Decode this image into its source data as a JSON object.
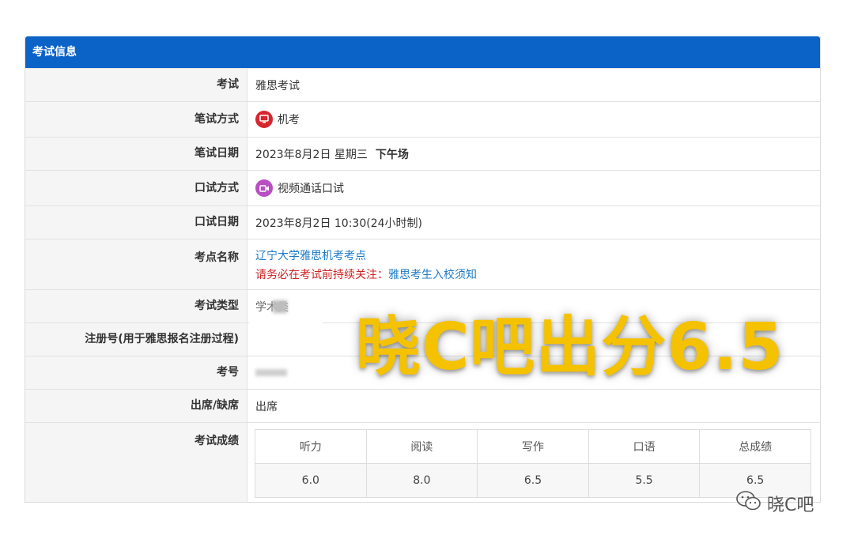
{
  "panel": {
    "title": "考试信息"
  },
  "rows": {
    "exam": {
      "label": "考试",
      "value": "雅思考试"
    },
    "written_mode": {
      "label": "笔试方式",
      "value": "机考",
      "icon": "monitor-icon"
    },
    "written_date": {
      "label": "笔试日期",
      "value": "2023年8月2日 星期三",
      "session": "下午场"
    },
    "oral_mode": {
      "label": "口试方式",
      "value": "视频通话口试",
      "icon": "video-icon"
    },
    "oral_date": {
      "label": "口试日期",
      "value": "2023年8月2日 10:30(24小时制)"
    },
    "site": {
      "label": "考点名称",
      "value": "辽宁大学雅思机考考点",
      "notice": "请务必在考试前持续关注：",
      "notice_link": "雅思考生入校须知"
    },
    "exam_type": {
      "label": "考试类型",
      "value": "学术类"
    },
    "registration": {
      "label": "注册号(用于雅思报名注册过程)"
    },
    "candidate_no": {
      "label": "考号"
    },
    "attendance": {
      "label": "出席/缺席",
      "value": "出席"
    },
    "results": {
      "label": "考试成绩"
    }
  },
  "scores": {
    "headers": [
      "听力",
      "阅读",
      "写作",
      "口语",
      "总成绩"
    ],
    "values": [
      "6.0",
      "8.0",
      "6.5",
      "5.5",
      "6.5"
    ]
  },
  "overlay": {
    "text": "晓C吧出分6.5"
  },
  "watermark": {
    "text": "晓C吧",
    "icon": "wechat-icon"
  },
  "colors": {
    "header": "#0b63c8",
    "link": "#1d7ac7",
    "warning": "#d02222",
    "overlay": "#f5c200"
  }
}
